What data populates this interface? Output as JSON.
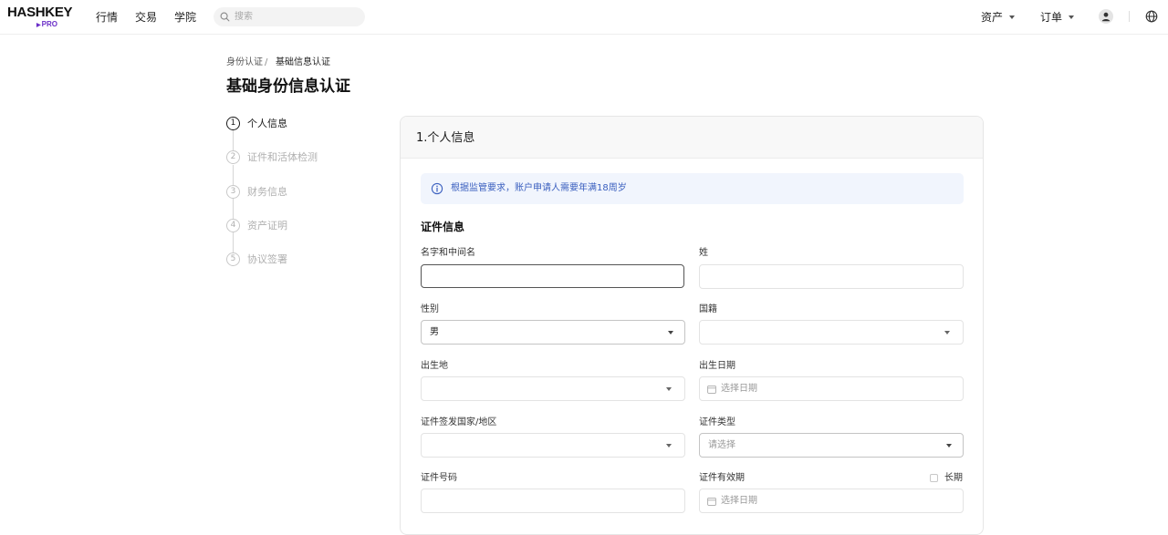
{
  "header": {
    "logo_main": "HASHKEY",
    "logo_sub": "PRO",
    "nav": [
      "行情",
      "交易",
      "学院"
    ],
    "search_placeholder": "搜索",
    "right_menu": [
      "资产",
      "订单"
    ]
  },
  "breadcrumb": {
    "parent": "身份认证",
    "separator": "/",
    "current": "基础信息认证"
  },
  "page_title": "基础身份信息认证",
  "steps": [
    {
      "number": "1",
      "label": "个人信息",
      "active": true
    },
    {
      "number": "2",
      "label": "证件和活体检测",
      "active": false
    },
    {
      "number": "3",
      "label": "财务信息",
      "active": false
    },
    {
      "number": "4",
      "label": "资产证明",
      "active": false
    },
    {
      "number": "5",
      "label": "协议签署",
      "active": false
    }
  ],
  "card": {
    "title": "1.个人信息",
    "notice": "根据监管要求，账户申请人需要年满18周岁",
    "section_title": "证件信息"
  },
  "form": {
    "first_name": {
      "label": "名字和中间名",
      "value": ""
    },
    "last_name": {
      "label": "姓",
      "value": ""
    },
    "gender": {
      "label": "性别",
      "value": "男"
    },
    "nationality": {
      "label": "国籍",
      "value": ""
    },
    "birthplace": {
      "label": "出生地",
      "value": ""
    },
    "birthdate": {
      "label": "出生日期",
      "placeholder": "选择日期"
    },
    "issuing_country": {
      "label": "证件签发国家/地区",
      "value": ""
    },
    "id_type": {
      "label": "证件类型",
      "placeholder": "请选择"
    },
    "id_number": {
      "label": "证件号码",
      "value": ""
    },
    "id_validity": {
      "label": "证件有效期",
      "placeholder": "选择日期",
      "long_term_label": "长期",
      "long_term_checked": false
    }
  },
  "colors": {
    "accent_purple": "#6b2fc8",
    "notice_bg": "#f1f5fd",
    "notice_text": "#3a5fbf"
  }
}
